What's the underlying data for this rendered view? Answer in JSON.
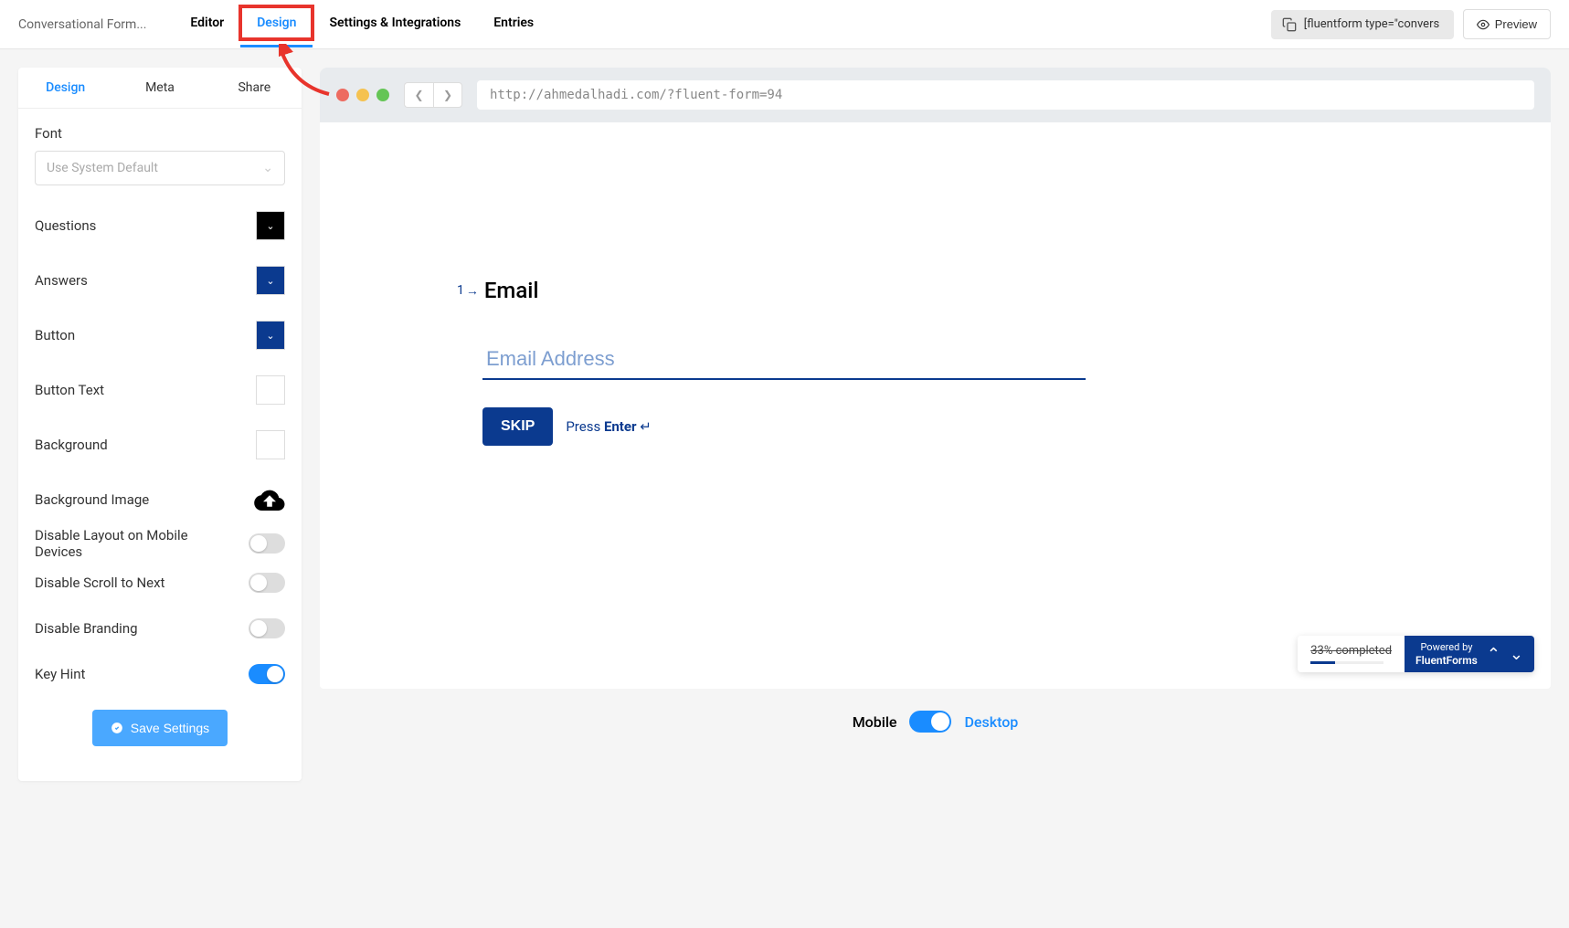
{
  "header": {
    "formTitle": "Conversational Form...",
    "tabs": [
      "Editor",
      "Design",
      "Settings & Integrations",
      "Entries"
    ],
    "activeTab": "Design",
    "shortcode": "[fluentform type=\"convers",
    "previewLabel": "Preview"
  },
  "sidebar": {
    "tabs": [
      "Design",
      "Meta",
      "Share"
    ],
    "activeTab": "Design",
    "fontLabel": "Font",
    "fontPlaceholder": "Use System Default",
    "settings": {
      "questions": {
        "label": "Questions",
        "color": "#000000"
      },
      "answers": {
        "label": "Answers",
        "color": "#0b3a8f"
      },
      "button": {
        "label": "Button",
        "color": "#0b3a8f"
      },
      "buttonText": {
        "label": "Button Text",
        "color": "#ffffff"
      },
      "background": {
        "label": "Background",
        "color": "#ffffff"
      },
      "backgroundImage": {
        "label": "Background Image"
      },
      "disableLayoutMobile": {
        "label": "Disable Layout on Mobile Devices",
        "value": false
      },
      "disableScrollNext": {
        "label": "Disable Scroll to Next",
        "value": false
      },
      "disableBranding": {
        "label": "Disable Branding",
        "value": false
      },
      "keyHint": {
        "label": "Key Hint",
        "value": true
      }
    },
    "saveLabel": "Save Settings"
  },
  "preview": {
    "url": "http://ahmedalhadi.com/?fluent-form=94",
    "questionNumber": "1",
    "questionLabel": "Email",
    "inputPlaceholder": "Email Address",
    "skipLabel": "SKIP",
    "hintPress": "Press",
    "hintKey": "Enter",
    "hintSymbol": "↵",
    "progressText": "33% completed",
    "progressPercent": 33,
    "poweredByLabel": "Powered by",
    "poweredByBrand": "FluentForms"
  },
  "deviceSwitch": {
    "mobile": "Mobile",
    "desktop": "Desktop",
    "active": "Desktop"
  }
}
